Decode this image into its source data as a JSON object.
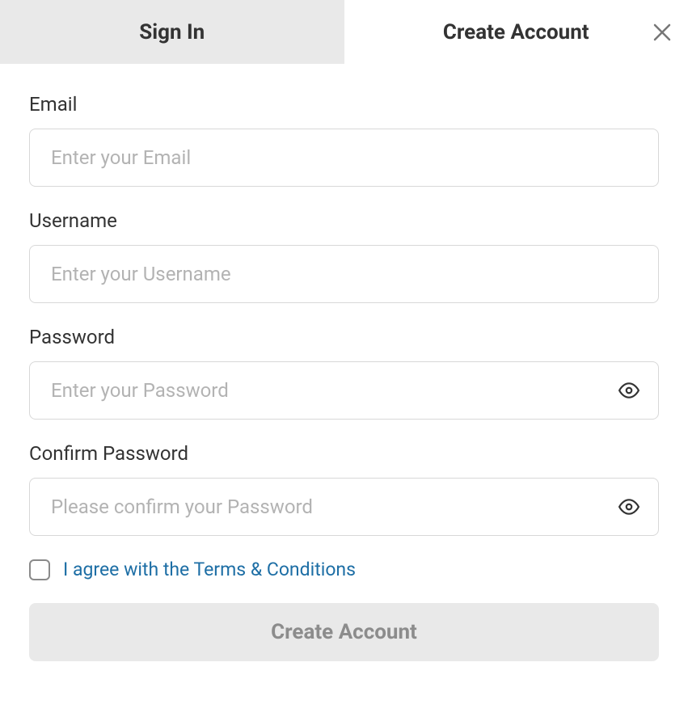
{
  "tabs": {
    "sign_in": "Sign In",
    "create_account": "Create Account"
  },
  "form": {
    "email": {
      "label": "Email",
      "placeholder": "Enter your Email",
      "value": ""
    },
    "username": {
      "label": "Username",
      "placeholder": "Enter your Username",
      "value": ""
    },
    "password": {
      "label": "Password",
      "placeholder": "Enter your Password",
      "value": ""
    },
    "confirm_password": {
      "label": "Confirm Password",
      "placeholder": "Please confirm your Password",
      "value": ""
    },
    "terms": {
      "label": "I agree with the Terms & Conditions",
      "checked": false
    },
    "submit_label": "Create Account"
  }
}
